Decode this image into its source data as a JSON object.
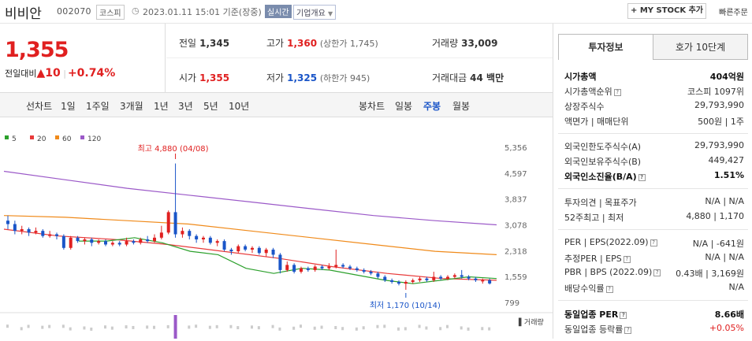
{
  "header": {
    "stock_name": "비비안",
    "stock_code": "002070",
    "market_badge": "코스피",
    "datetime": "2023.01.11 15:01 기준(장중)",
    "realtime_badge": "실시간",
    "company_overview": "기업개요",
    "my_stock_button": "+ MY STOCK 추가",
    "quick_order": "빠른주문"
  },
  "quote": {
    "price": "1,355",
    "change_label": "전일대비",
    "change_value": "▲10",
    "change_pct": "+0.74%",
    "prev_close_label": "전일",
    "prev_close": "1,345",
    "high_label": "고가",
    "high": "1,360",
    "upper_limit": "(상한가 1,745)",
    "volume_label": "거래량",
    "volume": "33,009",
    "open_label": "시가",
    "open": "1,355",
    "low_label": "저가",
    "low": "1,325",
    "lower_limit": "(하한가 945)",
    "amount_label": "거래대금",
    "amount": "44 백만"
  },
  "toolbar": {
    "line_chart": "선차트",
    "periods": [
      "1일",
      "1주일",
      "3개월",
      "1년",
      "3년",
      "5년",
      "10년"
    ],
    "candle_chart": "봉차트",
    "candles": [
      "일봉",
      "주봉",
      "월봉"
    ],
    "active_candle": "주봉"
  },
  "colors": {
    "up": "#e02020",
    "down": "#1a55c8",
    "ma5": "#2ca02c",
    "ma20": "#e83a3a",
    "ma60": "#f08a1a",
    "ma120": "#9b59c8"
  },
  "chart_data": {
    "type": "candlestick",
    "legend": [
      "5",
      "20",
      "60",
      "120"
    ],
    "y_ticks": [
      "5,356",
      "4,597",
      "3,837",
      "3,078",
      "2,318",
      "1,559",
      "799"
    ],
    "ylim": [
      799,
      5356
    ],
    "annotations": {
      "high": "최고 4,880 (04/08)",
      "low": "최저 1,170 (10/14)"
    },
    "volume_label": "거래량",
    "candles": [
      [
        3200,
        3100,
        3350,
        2950
      ],
      [
        3100,
        2900,
        3200,
        2800
      ],
      [
        2900,
        2950,
        3050,
        2800
      ],
      [
        2950,
        2850,
        3000,
        2750
      ],
      [
        2850,
        2900,
        3000,
        2800
      ],
      [
        2900,
        2750,
        2950,
        2700
      ],
      [
        2750,
        2800,
        2900,
        2700
      ],
      [
        2800,
        2750,
        2850,
        2650
      ],
      [
        2750,
        2400,
        2800,
        2350
      ],
      [
        2400,
        2700,
        2750,
        2350
      ],
      [
        2700,
        2600,
        2750,
        2550
      ],
      [
        2600,
        2650,
        2700,
        2500
      ],
      [
        2650,
        2550,
        2700,
        2450
      ],
      [
        2550,
        2600,
        2650,
        2500
      ],
      [
        2600,
        2500,
        2650,
        2450
      ],
      [
        2500,
        2550,
        2600,
        2450
      ],
      [
        2550,
        2500,
        2600,
        2450
      ],
      [
        2500,
        2600,
        2700,
        2450
      ],
      [
        2600,
        2550,
        2650,
        2500
      ],
      [
        2550,
        2650,
        2700,
        2500
      ],
      [
        2650,
        2600,
        2750,
        2550
      ],
      [
        2600,
        2700,
        2800,
        2550
      ],
      [
        2700,
        2850,
        3050,
        2650
      ],
      [
        2850,
        3450,
        3500,
        2800
      ],
      [
        3450,
        2800,
        4880,
        2700
      ],
      [
        2800,
        2900,
        3000,
        2700
      ],
      [
        2900,
        2750,
        2950,
        2650
      ],
      [
        2750,
        2650,
        2800,
        2550
      ],
      [
        2650,
        2700,
        2750,
        2550
      ],
      [
        2700,
        2550,
        2750,
        2500
      ],
      [
        2550,
        2600,
        2650,
        2450
      ],
      [
        2600,
        2350,
        2650,
        2300
      ],
      [
        2350,
        2300,
        2400,
        2200
      ],
      [
        2300,
        2450,
        2500,
        2250
      ],
      [
        2450,
        2350,
        2500,
        2300
      ],
      [
        2350,
        2400,
        2450,
        2250
      ],
      [
        2400,
        2250,
        2450,
        2200
      ],
      [
        2250,
        2350,
        2400,
        2150
      ],
      [
        2350,
        2200,
        2400,
        2100
      ],
      [
        2200,
        1750,
        2250,
        1650
      ],
      [
        1750,
        1900,
        2000,
        1700
      ],
      [
        1900,
        1700,
        1950,
        1650
      ],
      [
        1700,
        1800,
        1850,
        1650
      ],
      [
        1800,
        1750,
        1850,
        1700
      ],
      [
        1750,
        1850,
        1900,
        1700
      ],
      [
        1850,
        1800,
        1900,
        1750
      ],
      [
        1800,
        1850,
        1950,
        1750
      ],
      [
        1850,
        1900,
        2350,
        1800
      ],
      [
        1900,
        1850,
        1950,
        1800
      ],
      [
        1850,
        1800,
        1900,
        1750
      ],
      [
        1800,
        1750,
        1850,
        1700
      ],
      [
        1750,
        1700,
        1800,
        1650
      ],
      [
        1700,
        1650,
        1750,
        1600
      ],
      [
        1650,
        1550,
        1700,
        1500
      ],
      [
        1550,
        1450,
        1600,
        1400
      ],
      [
        1450,
        1400,
        1500,
        1350
      ],
      [
        1400,
        1350,
        1450,
        1300
      ],
      [
        1350,
        1400,
        1450,
        1170
      ],
      [
        1400,
        1450,
        1500,
        1350
      ],
      [
        1450,
        1500,
        1550,
        1400
      ],
      [
        1500,
        1450,
        1550,
        1400
      ],
      [
        1450,
        1550,
        1700,
        1400
      ],
      [
        1550,
        1500,
        1600,
        1450
      ],
      [
        1500,
        1550,
        1600,
        1450
      ],
      [
        1550,
        1600,
        1650,
        1500
      ],
      [
        1600,
        1550,
        1750,
        1500
      ],
      [
        1550,
        1500,
        1600,
        1450
      ],
      [
        1500,
        1450,
        1550,
        1400
      ],
      [
        1450,
        1450,
        1500,
        1350
      ],
      [
        1450,
        1355,
        1500,
        1325
      ]
    ],
    "ma120": [
      4650,
      4400,
      4150,
      3950,
      3750,
      3550,
      3350,
      3200,
      3078
    ],
    "ma60": [
      3350,
      3300,
      3200,
      3100,
      2900,
      2700,
      2500,
      2300,
      2200
    ],
    "ma20": [
      2950,
      2750,
      2650,
      2500,
      2300,
      2100,
      1850,
      1650,
      1500,
      1450
    ],
    "ma5_points": "2600,2600,2700,2550,2300,2200,1800,1650,1800,1750,1600,1450,1350,1450,1550,1500"
  },
  "invest_panel": {
    "tabs": [
      "투자정보",
      "호가 10단계"
    ],
    "market_cap_label": "시가총액",
    "market_cap": "404억원",
    "cap_rank_label": "시가총액순위",
    "cap_rank": "코스피 1097위",
    "shares_label": "상장주식수",
    "shares": "29,793,990",
    "par_label": "액면가 | 매매단위",
    "par": "500원 | 1주",
    "foreign_limit_label": "외국인한도주식수(A)",
    "foreign_limit": "29,793,990",
    "foreign_hold_label": "외국인보유주식수(B)",
    "foreign_hold": "449,427",
    "foreign_ratio_label": "외국인소진율(B/A)",
    "foreign_ratio": "1.51%",
    "opinion_label": "투자의견 | 목표주가",
    "opinion": "N/A | N/A",
    "week52_label": "52주최고 | 최저",
    "week52": "4,880 | 1,170",
    "per_label": "PER | EPS(2022.09)",
    "per": "N/A | -641원",
    "est_per_label": "추정PER | EPS",
    "est_per": "N/A | N/A",
    "pbr_label": "PBR | BPS (2022.09)",
    "pbr": "0.43배 | 3,169원",
    "div_label": "배당수익률",
    "div": "N/A",
    "peer_per_label": "동일업종 PER",
    "peer_per": "8.66배",
    "peer_rate_label": "동일업종 등락률",
    "peer_rate": "+0.05%"
  }
}
